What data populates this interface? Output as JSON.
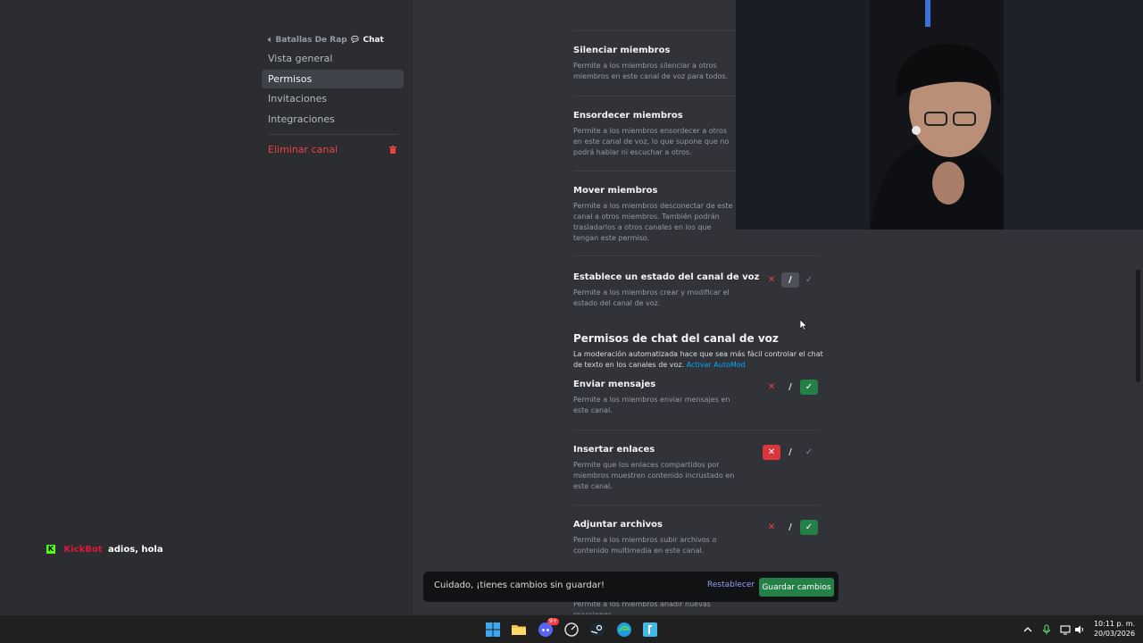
{
  "sidebar": {
    "breadcrumb": {
      "server": "Batallas De Rap",
      "channel": "Chat"
    },
    "items": [
      {
        "label": "Vista general"
      },
      {
        "label": "Permisos"
      },
      {
        "label": "Invitaciones"
      },
      {
        "label": "Integraciones"
      }
    ],
    "delete_label": "Eliminar canal"
  },
  "permissions": [
    {
      "title": "Silenciar miembros",
      "desc": "Permite a los miembros silenciar a otros miembros en este canal de voz para todos.",
      "state": "hidden"
    },
    {
      "title": "Ensordecer miembros",
      "desc": "Permite a los miembros ensordecer a otros en este canal de voz, lo que supone que no podrá hablar ni escuchar a otros.",
      "state": "hidden"
    },
    {
      "title": "Mover miembros",
      "desc": "Permite a los miembros desconectar de este canal a otros miembros. También podrán trasladarlos a otros canales en los que tengan este permiso.",
      "state": "hidden"
    },
    {
      "title": "Establece un estado del canal de voz",
      "desc": "Permite a los miembros crear y modificar el estado del canal de voz.",
      "state": "neutral"
    }
  ],
  "chat_section": {
    "title": "Permisos de chat del canal de voz",
    "desc": "La moderación automatizada hace que sea más fácil controlar el chat de texto en los canales de voz.",
    "link": "Activar AutoMod"
  },
  "chat_permissions": [
    {
      "title": "Enviar mensajes",
      "desc": "Permite a los miembros enviar mensajes en este canal.",
      "state": "allow"
    },
    {
      "title": "Insertar enlaces",
      "desc": "Permite que los enlaces compartidos por miembros muestren contenido incrustado en este canal.",
      "state": "deny"
    },
    {
      "title": "Adjuntar archivos",
      "desc": "Permite a los miembros subir archivos o contenido multimedia en este canal.",
      "state": "allow"
    },
    {
      "title": "",
      "desc": "Permite a los miembros añadir nuevas reacciones",
      "state": "hidden"
    }
  ],
  "toggle": {
    "deny": "✕",
    "neutral": "/",
    "allow": "✓"
  },
  "unsaved_bar": {
    "message": "Cuidado, ¡tienes cambios sin guardar!",
    "reset_label": "Restablecer",
    "save_label": "Guardar cambios"
  },
  "chat_overlay": {
    "user": "KickBot",
    "message": "adios, hola",
    "logo": "K"
  },
  "taskbar": {
    "time": "10:11 p. m.",
    "date": "20/03/2026",
    "discord_badge": "9+"
  },
  "colors": {
    "allow": "#248046",
    "deny": "#da373c",
    "neutral": "#4e5058",
    "link": "#00a8fc",
    "reset": "#949cf7"
  }
}
